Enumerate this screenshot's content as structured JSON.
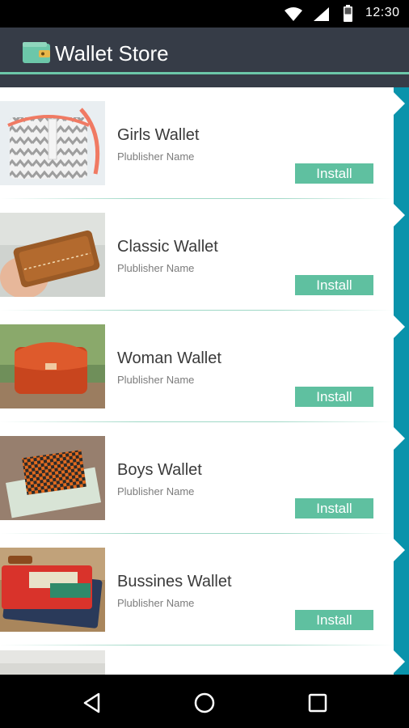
{
  "status_bar": {
    "time": "12:30",
    "icons": [
      "wifi-icon",
      "cell-signal-icon",
      "battery-icon"
    ]
  },
  "app_bar": {
    "title": "Wallet Store",
    "icon": "wallet-icon"
  },
  "colors": {
    "app_bar": "#363c47",
    "accent_line": "#6cc7a9",
    "install_button": "#5fc0a0",
    "right_rail": "#0a93ab"
  },
  "items": [
    {
      "name": "Girls Wallet",
      "publisher": "Plublisher Name",
      "action": "Install",
      "image": "gray-zigzag-bag-photo"
    },
    {
      "name": "Classic Wallet",
      "publisher": "Plublisher Name",
      "action": "Install",
      "image": "brown-leather-wallet-photo"
    },
    {
      "name": "Woman Wallet",
      "publisher": "Plublisher Name",
      "action": "Install",
      "image": "orange-leather-purse-photo"
    },
    {
      "name": "Boys Wallet",
      "publisher": "Plublisher Name",
      "action": "Install",
      "image": "woven-wallet-with-cash-photo"
    },
    {
      "name": "Bussines Wallet",
      "publisher": "Plublisher Name",
      "action": "Install",
      "image": "red-card-wallet-photo"
    }
  ],
  "nav_bar": {
    "buttons": [
      "back-icon",
      "home-icon",
      "recents-icon"
    ]
  }
}
